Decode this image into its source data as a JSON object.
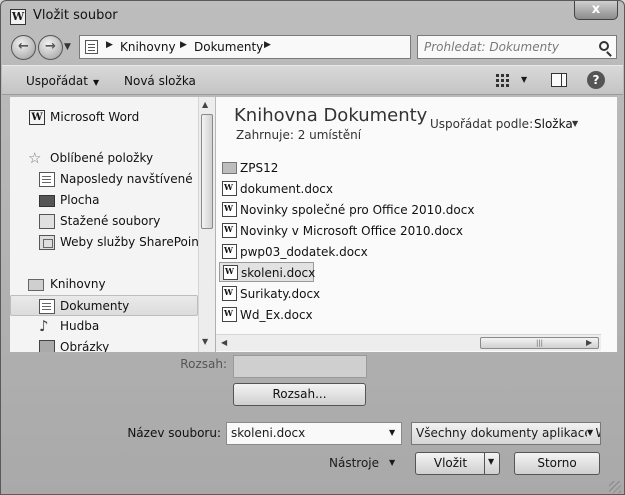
{
  "window": {
    "title": "Vložit soubor",
    "close": "x"
  },
  "address": {
    "crumbs": [
      "Knihovny",
      "Dokumenty"
    ],
    "search_placeholder": "Prohledat: Dokumenty"
  },
  "toolbar": {
    "organize": "Uspořádat",
    "new_folder": "Nová složka",
    "help": "?"
  },
  "sidebar": {
    "word": "Microsoft Word",
    "favorites": "Oblíbené položky",
    "fav_items": [
      "Naposledy navštívené",
      "Plocha",
      "Stažené soubory",
      "Weby služby SharePoint"
    ],
    "libraries": "Knihovny",
    "lib_items": [
      "Dokumenty",
      "Hudba",
      "Obrázky"
    ]
  },
  "library": {
    "title": "Knihovna Dokumenty",
    "subtitle": "Zahrnuje:  2 umístění",
    "arrange_label": "Uspořádat podle:",
    "arrange_value": "Složka"
  },
  "files": [
    "ZPS12",
    "dokument.docx",
    "Novinky společné pro Office 2010.docx",
    "Novinky v Microsoft Office 2010.docx",
    "pwp03_dodatek.docx",
    "skoleni.docx",
    "Surikaty.docx",
    "Wd_Ex.docx"
  ],
  "selected_file": "skoleni.docx",
  "bottom": {
    "range_label": "Rozsah:",
    "range_button": "Rozsah...",
    "filename_label": "Název souboru:",
    "filename_value": "skoleni.docx",
    "filetype_value": "Všechny dokumenty aplikace W",
    "tools": "Nástroje",
    "insert": "Vložit",
    "cancel": "Storno"
  }
}
